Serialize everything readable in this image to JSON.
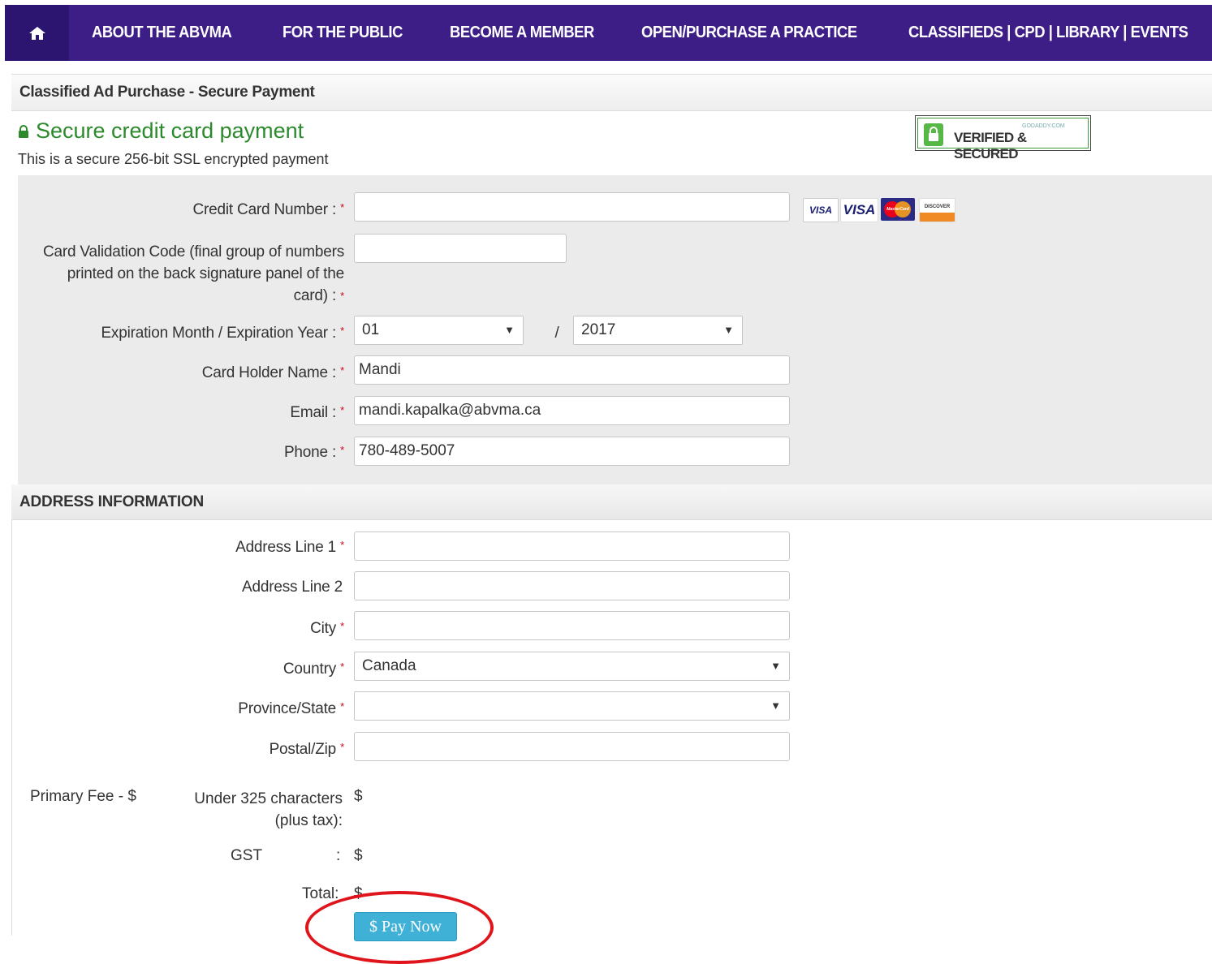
{
  "nav": {
    "home_icon": "home-icon",
    "items": [
      "ABOUT THE ABVMA",
      "FOR THE PUBLIC",
      "BECOME A MEMBER",
      "OPEN/PURCHASE A PRACTICE",
      "CLASSIFIEDS | CPD | LIBRARY | EVENTS"
    ]
  },
  "panel": {
    "title": "Classified Ad Purchase - Secure Payment"
  },
  "secure": {
    "title": "Secure credit card payment",
    "subtitle": "This is a secure 256-bit SSL encrypted payment",
    "badge_small": "GODADDY.COM",
    "badge_text": "VERIFIED & SECURED"
  },
  "card_logos": [
    "VISA",
    "VISA",
    "MasterCard",
    "DISCOVER"
  ],
  "form": {
    "required_mark": "*",
    "cc_number_label": "Credit Card Number :",
    "cc_number_value": "",
    "cvc_label_1": "Card Validation Code (final group of numbers",
    "cvc_label_2": "printed on the back signature panel of the",
    "cvc_label_3": "card) :",
    "cvc_value": "",
    "expiry_label": "Expiration Month / Expiration Year :",
    "expiry_month": "01",
    "expiry_sep": "/",
    "expiry_year": "2017",
    "holder_label": "Card Holder Name :",
    "holder_value": "Mandi",
    "email_label": "Email :",
    "email_value": "mandi.kapalka@abvma.ca",
    "phone_label": "Phone :",
    "phone_value": "780-489-5007"
  },
  "address": {
    "header": "ADDRESS INFORMATION",
    "line1_label": "Address Line 1",
    "line1_value": "",
    "line2_label": "Address Line 2",
    "line2_value": "",
    "city_label": "City",
    "city_value": "",
    "country_label": "Country",
    "country_value": "Canada",
    "province_label": "Province/State",
    "province_value": "",
    "postal_label": "Postal/Zip",
    "postal_value": ""
  },
  "fees": {
    "primary_label": "Primary Fee - $",
    "under_label_1": "Under 325 characters",
    "under_label_2": "(plus tax):",
    "under_value": "$",
    "gst_label": "GST",
    "gst_colon": ":",
    "gst_value": "$",
    "total_label": "Total:",
    "total_value": "$"
  },
  "pay_button": {
    "label": "$ Pay Now"
  },
  "colors": {
    "nav": "#3d1e86",
    "secure_green": "#2c8a2c",
    "pay_button": "#3fb0d6",
    "highlight": "#e0141b"
  }
}
